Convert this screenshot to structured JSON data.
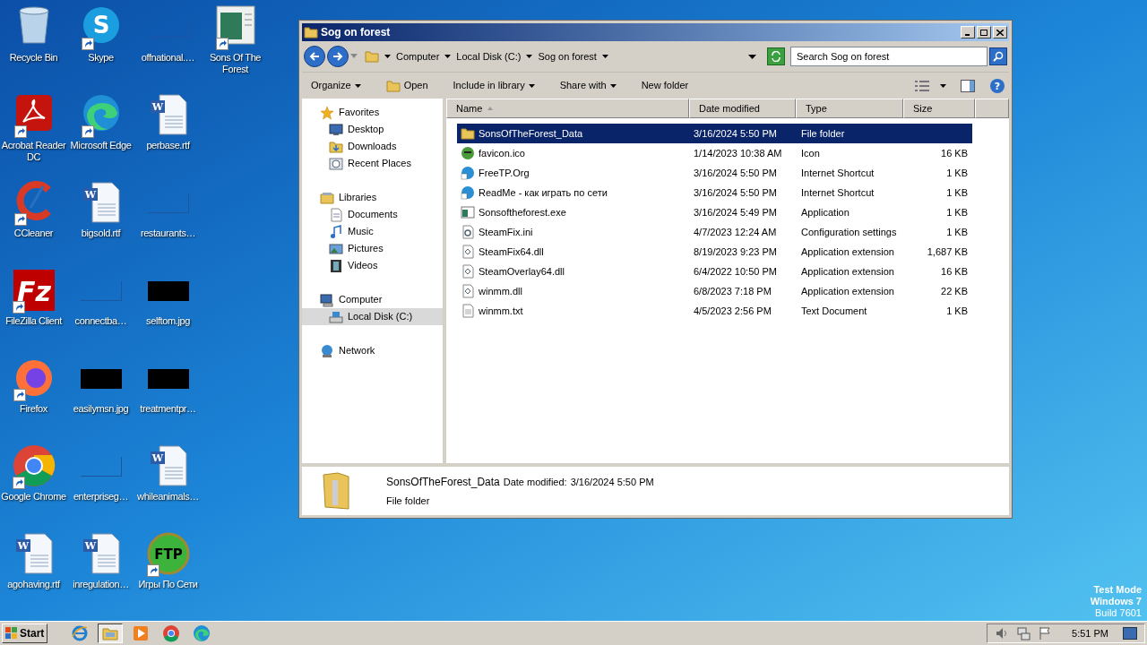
{
  "desktop_icons": [
    {
      "label": "Recycle Bin",
      "kind": "recycle",
      "shortcut": false
    },
    {
      "label": "Acrobat Reader DC",
      "kind": "acrobat",
      "shortcut": true
    },
    {
      "label": "CCleaner",
      "kind": "ccleaner",
      "shortcut": true
    },
    {
      "label": "FileZilla Client",
      "kind": "filezilla",
      "shortcut": true,
      "logo_text": "Fz"
    },
    {
      "label": "Firefox",
      "kind": "firefox",
      "shortcut": true
    },
    {
      "label": "Google Chrome",
      "kind": "chrome",
      "shortcut": true
    },
    {
      "label": "agohaving.rtf",
      "kind": "word",
      "shortcut": false,
      "logo_text": "W"
    },
    {
      "label": "Skype",
      "kind": "skype",
      "shortcut": true,
      "logo_text": "S"
    },
    {
      "label": "Microsoft Edge",
      "kind": "edge",
      "shortcut": true
    },
    {
      "label": "bigsold.rtf",
      "kind": "word",
      "shortcut": false,
      "logo_text": "W"
    },
    {
      "label": "connectba…",
      "kind": "blank",
      "shortcut": false
    },
    {
      "label": "easilymsn.jpg",
      "kind": "image",
      "shortcut": false
    },
    {
      "label": "enterpriseg…",
      "kind": "blank",
      "shortcut": false
    },
    {
      "label": "inregulation…",
      "kind": "word",
      "shortcut": false,
      "logo_text": "W"
    },
    {
      "label": "offnational.…",
      "kind": "blank",
      "shortcut": false
    },
    {
      "label": "perbase.rtf",
      "kind": "word",
      "shortcut": false,
      "logo_text": "W"
    },
    {
      "label": "restaurants…",
      "kind": "blank",
      "shortcut": false
    },
    {
      "label": "selftom.jpg",
      "kind": "image",
      "shortcut": false
    },
    {
      "label": "treatmentpr…",
      "kind": "image",
      "shortcut": false
    },
    {
      "label": "whileanimals…",
      "kind": "word",
      "shortcut": false,
      "logo_text": "W"
    },
    {
      "label": "Игры По Сети",
      "kind": "ftp",
      "shortcut": true,
      "logo_text": "FTP"
    },
    {
      "label": "Sons Of The Forest",
      "kind": "app",
      "shortcut": true
    }
  ],
  "window": {
    "title": "Sog on forest",
    "breadcrumb": [
      "Computer",
      "Local Disk (C:)",
      "Sog on forest"
    ],
    "search": {
      "placeholder": "Search Sog on forest"
    },
    "toolbar": [
      {
        "label": "Organize",
        "menu": true,
        "icon": false
      },
      {
        "label": "Open",
        "menu": false,
        "icon": true
      },
      {
        "label": "Include in library",
        "menu": true,
        "icon": false
      },
      {
        "label": "Share with",
        "menu": true,
        "icon": false
      },
      {
        "label": "New folder",
        "menu": false,
        "icon": false
      }
    ],
    "nav": [
      {
        "label": "Favorites",
        "kind": "star",
        "selected": false,
        "children": [
          {
            "label": "Desktop",
            "kind": "desktop",
            "selected": false
          },
          {
            "label": "Downloads",
            "kind": "downloads",
            "selected": false
          },
          {
            "label": "Recent Places",
            "kind": "recent",
            "selected": false
          }
        ]
      },
      {
        "label": "Libraries",
        "kind": "library",
        "selected": false,
        "children": [
          {
            "label": "Documents",
            "kind": "documents",
            "selected": false
          },
          {
            "label": "Music",
            "kind": "music",
            "selected": false
          },
          {
            "label": "Pictures",
            "kind": "pictures",
            "selected": false
          },
          {
            "label": "Videos",
            "kind": "videos",
            "selected": false
          }
        ]
      },
      {
        "label": "Computer",
        "kind": "computer",
        "selected": false,
        "children": [
          {
            "label": "Local Disk (C:)",
            "kind": "disk",
            "selected": true
          }
        ]
      },
      {
        "label": "Network",
        "kind": "network",
        "selected": false
      }
    ],
    "help_glyph": "?",
    "columns": [
      {
        "label": "Name",
        "sorted": true
      },
      {
        "label": "Date modified",
        "sorted": false
      },
      {
        "label": "Type",
        "sorted": false
      },
      {
        "label": "Size",
        "sorted": false
      }
    ],
    "files": [
      {
        "name": "SonsOfTheForest_Data",
        "date": "3/16/2024 5:50 PM",
        "type": "File folder",
        "kind": "folder",
        "selected": true
      },
      {
        "name": "favicon.ico",
        "date": "1/14/2023 10:38 AM",
        "type": "Icon",
        "size": "16 KB",
        "kind": "ico",
        "selected": false
      },
      {
        "name": "FreeTP.Org",
        "date": "3/16/2024 5:50 PM",
        "type": "Internet Shortcut",
        "size": "1 KB",
        "kind": "url",
        "selected": false
      },
      {
        "name": "ReadMe - как играть по сети",
        "date": "3/16/2024 5:50 PM",
        "type": "Internet Shortcut",
        "size": "1 KB",
        "kind": "url",
        "selected": false
      },
      {
        "name": "Sonsoftheforest.exe",
        "date": "3/16/2024 5:49 PM",
        "type": "Application",
        "size": "1 KB",
        "kind": "exe",
        "selected": false
      },
      {
        "name": "SteamFix.ini",
        "date": "4/7/2023 12:24 AM",
        "type": "Configuration settings",
        "size": "1 KB",
        "kind": "ini",
        "selected": false
      },
      {
        "name": "SteamFix64.dll",
        "date": "8/19/2023 9:23 PM",
        "type": "Application extension",
        "size": "1,687 KB",
        "kind": "dll",
        "selected": false
      },
      {
        "name": "SteamOverlay64.dll",
        "date": "6/4/2022 10:50 PM",
        "type": "Application extension",
        "size": "16 KB",
        "kind": "dll",
        "selected": false
      },
      {
        "name": "winmm.dll",
        "date": "6/8/2023 7:18 PM",
        "type": "Application extension",
        "size": "22 KB",
        "kind": "dll",
        "selected": false
      },
      {
        "name": "winmm.txt",
        "date": "4/5/2023 2:56 PM",
        "type": "Text Document",
        "size": "1 KB",
        "kind": "txt",
        "selected": false
      }
    ],
    "details": {
      "name": "SonsOfTheForest_Data",
      "date_label": "Date modified:",
      "date": "3/16/2024 5:50 PM",
      "type": "File folder"
    }
  },
  "watermark_text": [
    "Test Mode",
    "Windows 7",
    "Build 7601"
  ],
  "taskbar": {
    "start": "Start",
    "apps": [
      {
        "kind": "ie",
        "active": false
      },
      {
        "kind": "explorer",
        "active": true
      },
      {
        "kind": "media",
        "active": false
      },
      {
        "kind": "chrome",
        "active": false
      },
      {
        "kind": "edge",
        "active": false
      }
    ],
    "clock": "5:51 PM"
  }
}
